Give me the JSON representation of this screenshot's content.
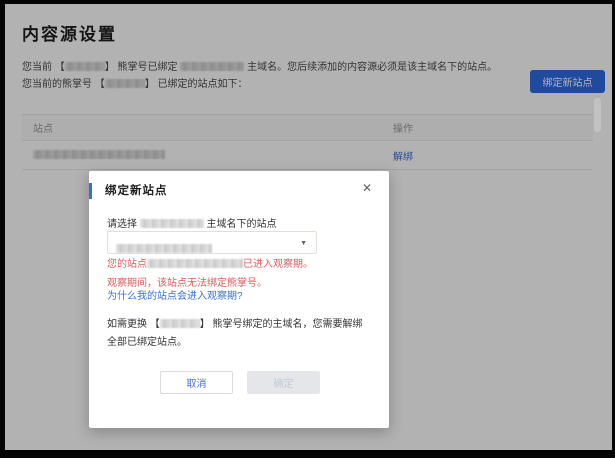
{
  "page": {
    "title": "内容源设置",
    "intro": {
      "l1a": "您当前 【",
      "l1b": "】 熊掌号已绑定 ",
      "l1c": " 主域名。您后续添加的内容源必须是该主域名下的站点。",
      "l2a": "您当前的熊掌号 【",
      "l2b": "】 已绑定的站点如下："
    },
    "bind_button_label": "绑定新站点"
  },
  "table": {
    "columns": {
      "site": "站点",
      "action": "操作"
    },
    "row_action_label": "解绑"
  },
  "modal": {
    "title": "绑定新站点",
    "close_icon": "✕",
    "select_label_a": "请选择 ",
    "select_label_b": " 主域名下的站点",
    "caret_icon": "▼",
    "warning1_a": "您的站点",
    "warning1_b": "已进入观察期。",
    "warning2": "观察期间，该站点无法绑定熊掌号。",
    "help_link": "为什么我的站点会进入观察期?",
    "note_a": "如需更换 【",
    "note_b": "】 熊掌号绑定的主域名，您需要解绑全部已绑定站点。",
    "cancel_label": "取消",
    "confirm_label": "确定"
  },
  "colors": {
    "primary_blue": "#2d6ae3",
    "link_blue": "#3a6fd8",
    "danger_red": "#e05a5a"
  }
}
